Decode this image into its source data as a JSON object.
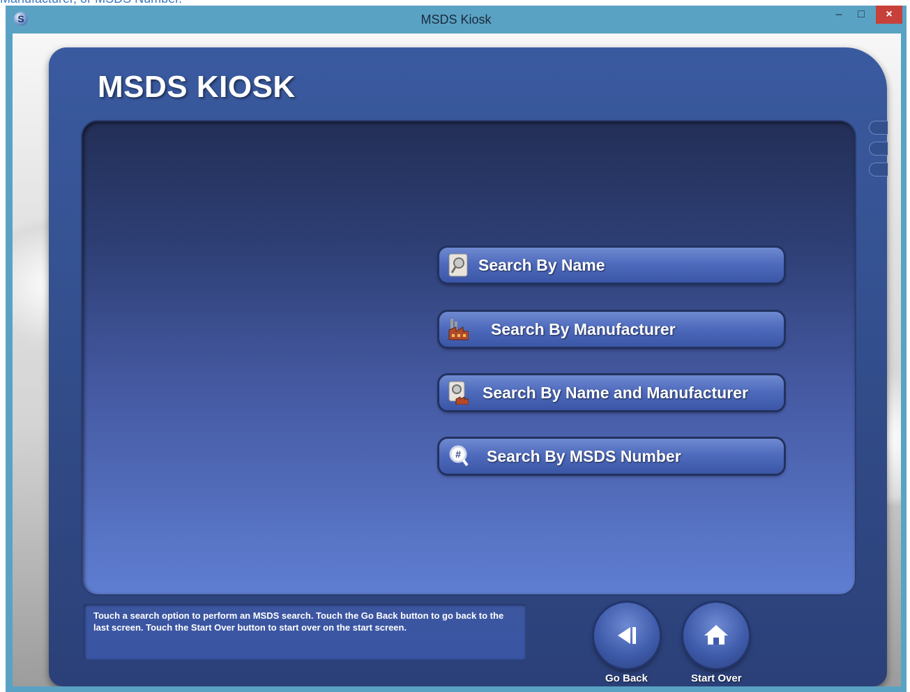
{
  "overlay_text": "Manufacturer, or MSDS Number.",
  "window": {
    "title": "MSDS Kiosk",
    "minimize_icon": "minimize-icon",
    "maximize_icon": "maximize-icon",
    "close_icon": "close-icon",
    "minimize_glyph": "–",
    "maximize_glyph": "□",
    "close_glyph": "×"
  },
  "app": {
    "heading": "MSDS KIOSK",
    "search_options": [
      {
        "label": "Search By Name",
        "icon": "person-search-icon"
      },
      {
        "label": "Search By Manufacturer",
        "icon": "factory-icon"
      },
      {
        "label": "Search By Name and Manufacturer",
        "icon": "person-factory-icon"
      },
      {
        "label": "Search By MSDS Number",
        "icon": "number-search-icon"
      }
    ],
    "help_text": "Touch a search option to perform an MSDS search. Touch the Go Back button to go back to the last screen. Touch the Start Over button to start over on the start screen.",
    "go_back_label": "Go Back",
    "start_over_label": "Start Over"
  },
  "colors": {
    "titlebar": "#5aa2c4",
    "panel": "#34508f",
    "button": "#4f6bbd",
    "close": "#c7413a"
  }
}
